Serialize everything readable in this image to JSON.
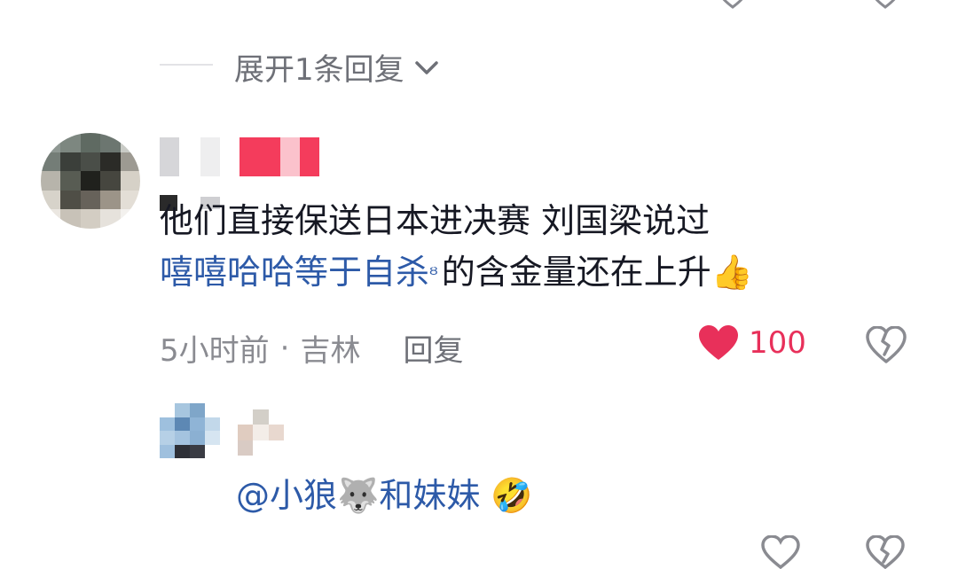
{
  "colors": {
    "like_red": "#e8305a",
    "link_blue": "#2d5aa8",
    "meta_gray": "#8a8b91",
    "text_dark": "#161823"
  },
  "thread": {
    "expand_label": "展开1条回复",
    "icons": {
      "expand": "chevron-down-icon"
    }
  },
  "comment": {
    "text_line1": "他们直接保送日本进决赛 刘国梁说过",
    "link_text": "嘻嘻哈哈等于自杀",
    "search_glyph": "ᴽ",
    "text_rest": "的含金量还在上升",
    "emoji": "👍",
    "time": "5小时前",
    "location": "吉林",
    "reply_label": "回复",
    "like_count": "100",
    "icons": {
      "like": "heart-filled-icon",
      "dislike": "broken-heart-icon"
    }
  },
  "reply": {
    "text": "@小狼🐺和妹妹",
    "emoji": "🤣",
    "icons": {
      "like": "heart-outline-icon",
      "dislike": "broken-heart-icon"
    }
  }
}
